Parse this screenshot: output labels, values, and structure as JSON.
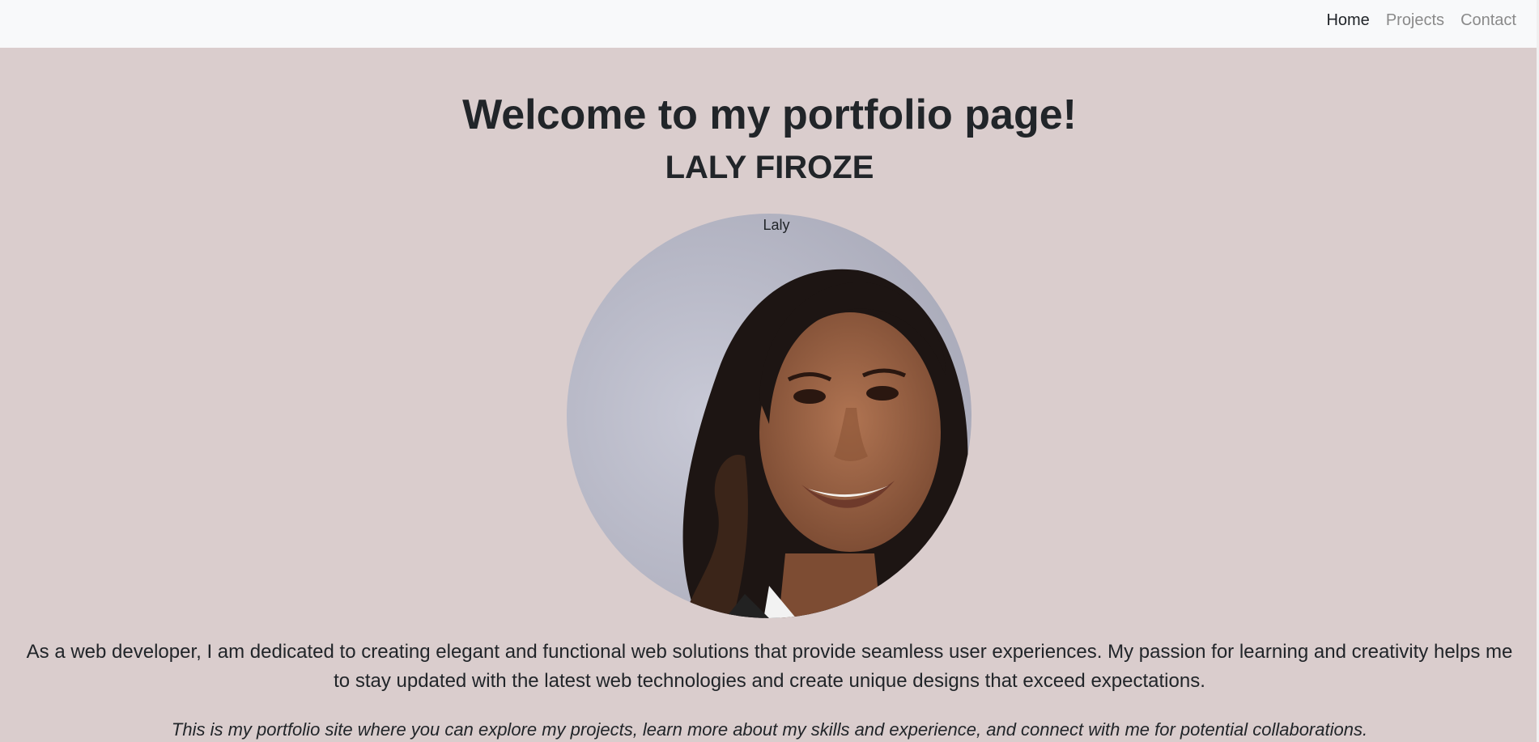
{
  "nav": {
    "items": [
      {
        "label": "Home",
        "active": true
      },
      {
        "label": "Projects",
        "active": false
      },
      {
        "label": "Contact",
        "active": false
      }
    ]
  },
  "hero": {
    "title": "Welcome to my portfolio page!",
    "name": "LALY FIROZE",
    "portrait_alt": "Laly"
  },
  "about": {
    "intro": "As a web developer, I am dedicated to creating elegant and functional web solutions that provide seamless user experiences. My passion for learning and creativity helps me to stay updated with the latest web technologies and create unique designs that exceed expectations.",
    "tagline": "This is my portfolio site where you can explore my projects, learn more about my skills and experience, and connect with me for potential collaborations."
  },
  "colors": {
    "page_background": "#dacdcd",
    "navbar_background": "#f8f9fa",
    "text": "#212529",
    "nav_inactive": "#8a8a8a"
  }
}
